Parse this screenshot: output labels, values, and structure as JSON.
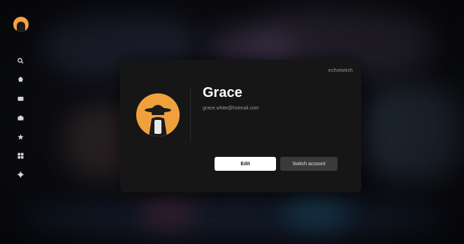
{
  "app": {
    "brand": "echotwitch",
    "nav": [
      {
        "icon": "search-icon"
      },
      {
        "icon": "home-icon"
      },
      {
        "icon": "tv-icon"
      },
      {
        "icon": "bookmark-icon"
      },
      {
        "icon": "star-icon"
      },
      {
        "icon": "grid-icon"
      },
      {
        "icon": "gear-icon"
      }
    ]
  },
  "profile": {
    "name": "Grace",
    "email": "grace.white@hotmail.com",
    "avatar_icon": "spy-avatar-icon"
  },
  "actions": {
    "edit_label": "Edit",
    "switch_label": "Switch account"
  },
  "colors": {
    "accent": "#f0a13b",
    "dialog_bg": "#161616",
    "primary_button": "#ffffff",
    "secondary_button": "#3a3a3a"
  }
}
